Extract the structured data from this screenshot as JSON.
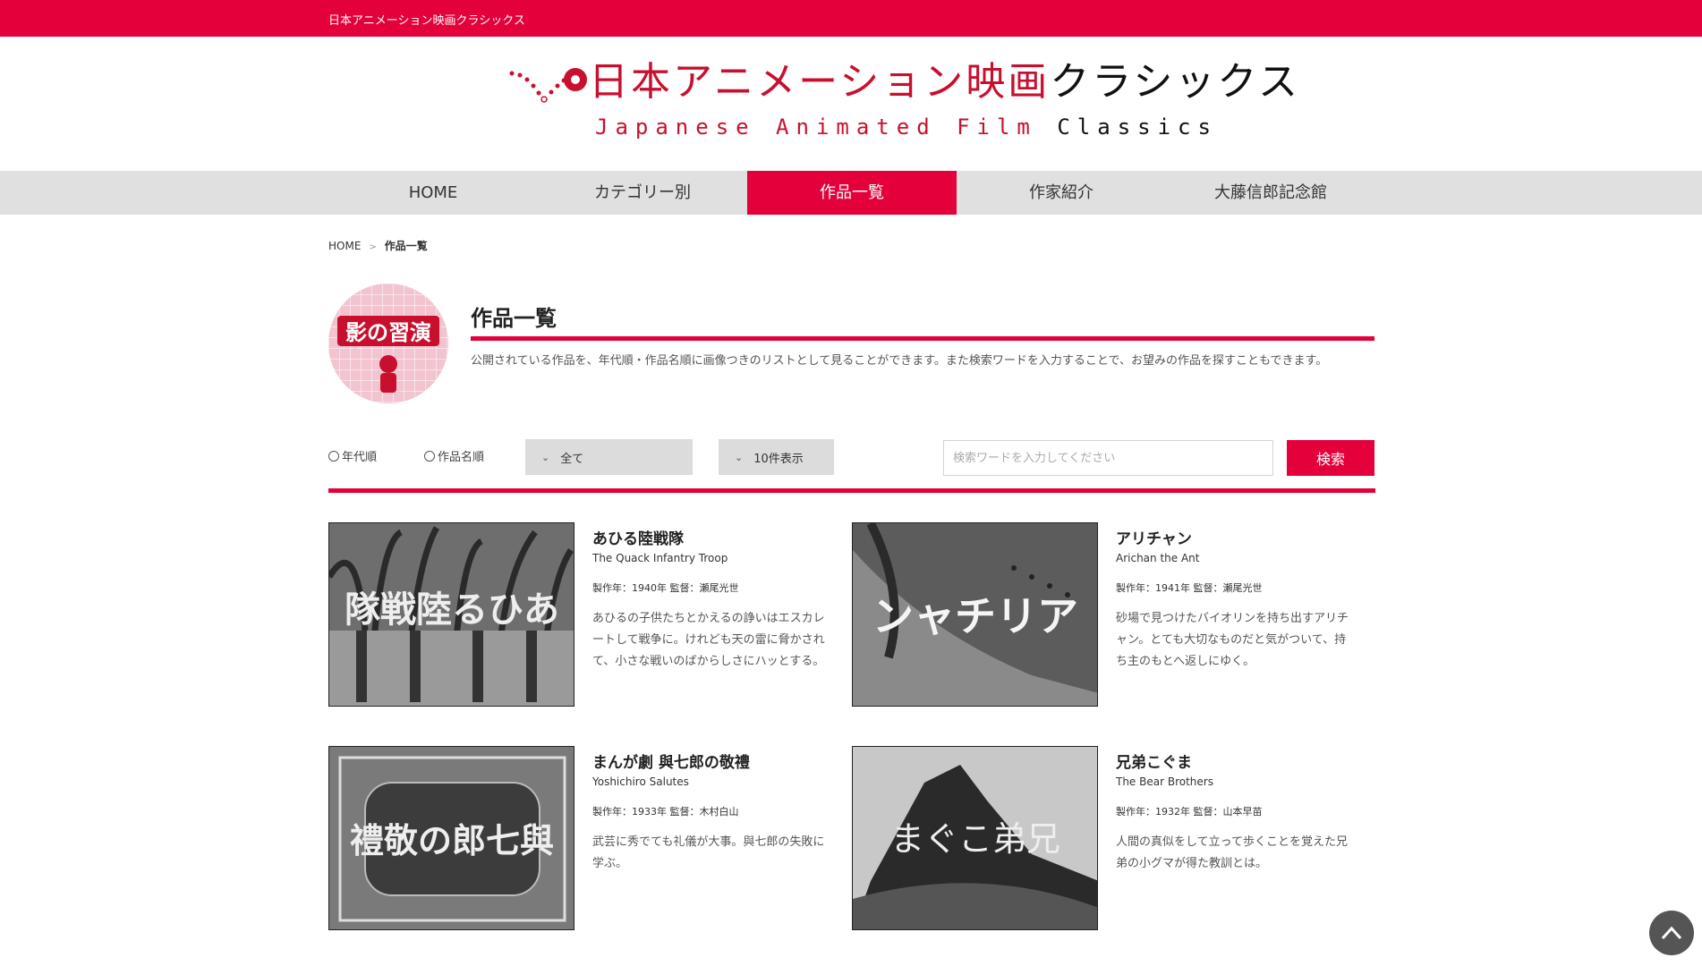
{
  "topbar": {
    "site_name": "日本アニメーション映画クラシックス"
  },
  "logo": {
    "ja_red": "日本アニメーション映画",
    "ja_black": "クラシックス",
    "en_red": "Japanese Animated Film",
    "en_black": "Classics"
  },
  "nav": {
    "items": [
      {
        "label": "HOME",
        "active": false
      },
      {
        "label": "カテゴリー別",
        "active": false
      },
      {
        "label": "作品一覧",
        "active": true
      },
      {
        "label": "作家紹介",
        "active": false
      },
      {
        "label": "大藤信郎記念館",
        "active": false
      }
    ]
  },
  "breadcrumb": {
    "home": "HOME",
    "separator": ">",
    "current": "作品一覧"
  },
  "page": {
    "title": "作品一覧",
    "description": "公開されている作品を、年代順・作品名順に画像つきのリストとして見ることができます。また検索ワードを入力することで、お望みの作品を探すこともできます。"
  },
  "controls": {
    "sort_year": "年代順",
    "sort_title": "作品名順",
    "category_select": "全て",
    "count_select": "10件表示",
    "search_placeholder": "検索ワードを入力してください",
    "search_value": "",
    "search_button": "検索"
  },
  "works": [
    {
      "title": "あひる陸戦隊",
      "title_en": "The Quack Infantry Troop",
      "meta": "製作年：1940年 監督：瀬尾光世",
      "description": "あひるの子供たちとかえるの諍いはエスカレートして戦争に。けれども天の雷に脅かされて、小さな戦いのばからしさにハッとする。",
      "thumb_text": "隊戦陸るひあ"
    },
    {
      "title": "アリチャン",
      "title_en": "Arichan the Ant",
      "meta": "製作年：1941年 監督：瀬尾光世",
      "description": "砂場で見つけたバイオリンを持ち出すアリチャン。とても大切なものだと気がついて、持ち主のもとへ返しにゆく。",
      "thumb_text": "ンャチリア"
    },
    {
      "title": "まんが劇 與七郎の敬禮",
      "title_en": "Yoshichiro Salutes",
      "meta": "製作年：1933年 監督：木村白山",
      "description": "武芸に秀でても礼儀が大事。與七郎の失敗に学ぶ。",
      "thumb_text": "禮敬の郎七與"
    },
    {
      "title": "兄弟こぐま",
      "title_en": "The Bear Brothers",
      "meta": "製作年：1932年 監督：山本早苗",
      "description": "人間の真似をして立って歩くことを覚えた兄弟の小グマが得た教訓とは。",
      "thumb_text": "まぐこ弟兄"
    }
  ],
  "page_icon": {
    "text": "影の習演"
  },
  "colors": {
    "accent": "#e4003a",
    "nav_bg": "#e0e0e0",
    "select_bg": "#dcdcdc"
  }
}
